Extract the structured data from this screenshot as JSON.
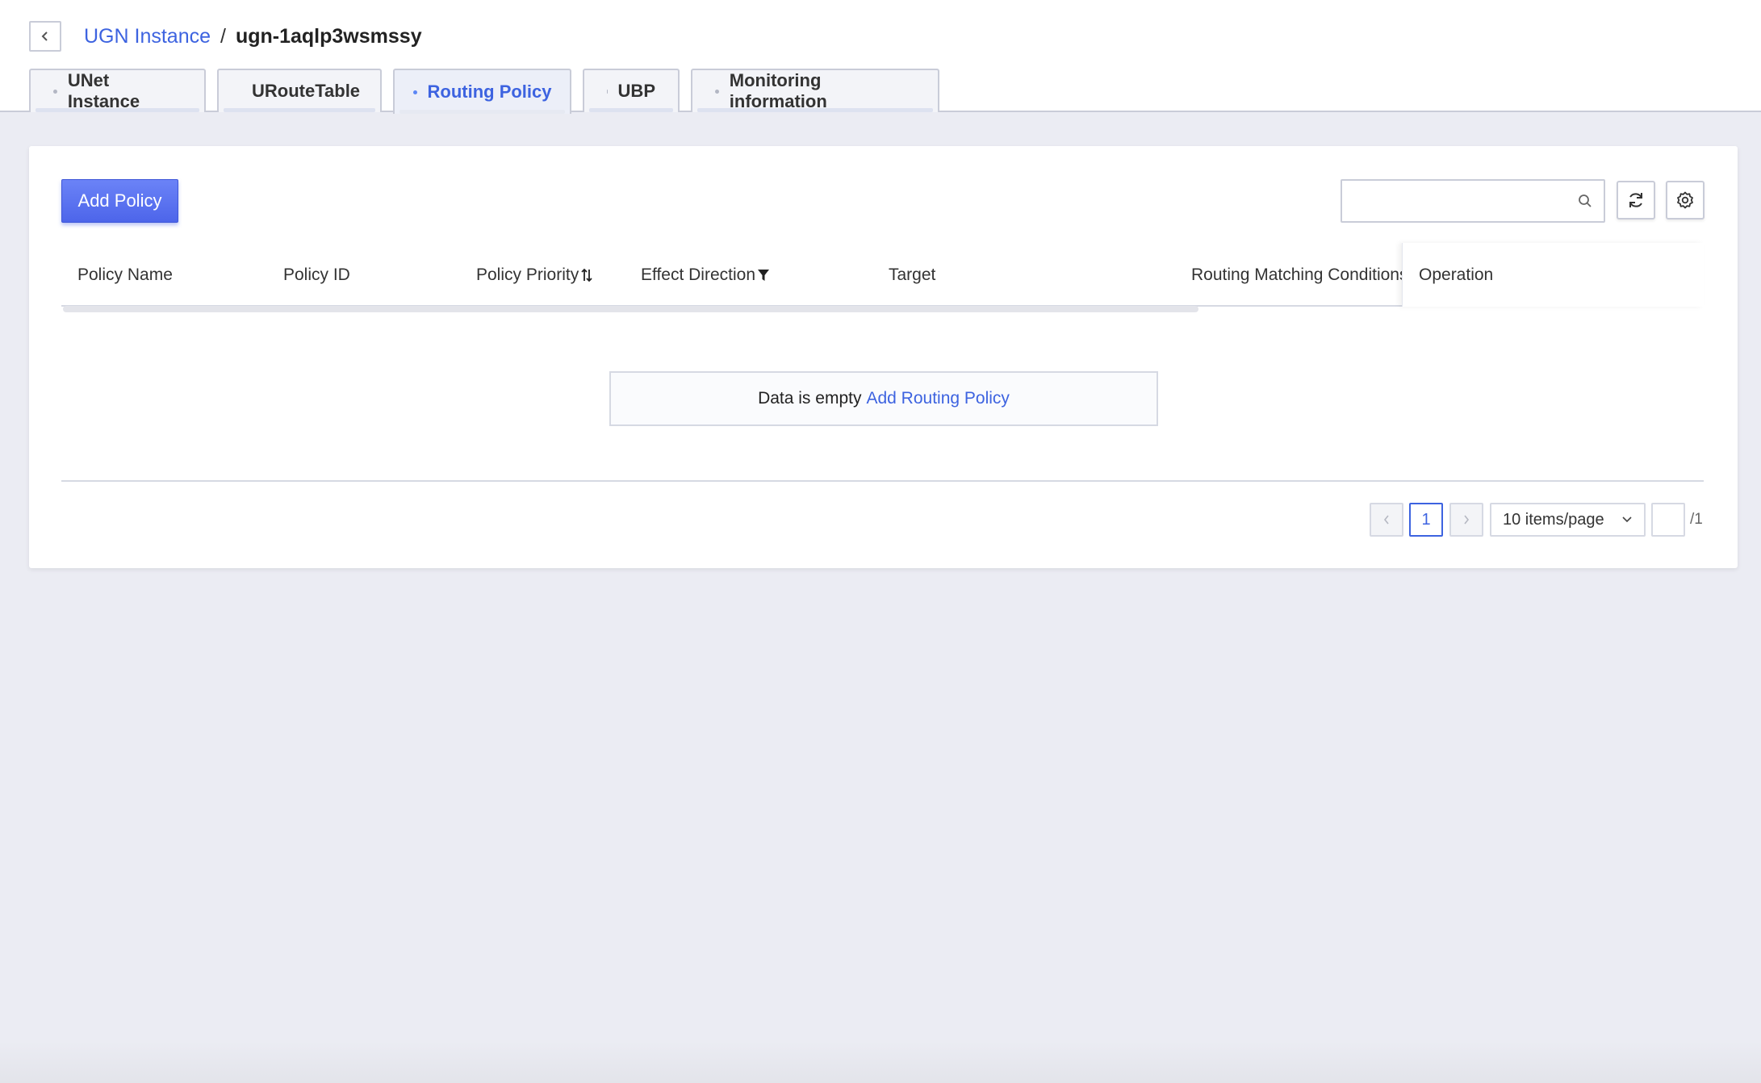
{
  "breadcrumb": {
    "parent": "UGN Instance",
    "separator": "/",
    "current": "ugn-1aqlp3wsmssy"
  },
  "tabs": [
    {
      "label": "UNet Instance",
      "active": false
    },
    {
      "label": "URouteTable",
      "active": false
    },
    {
      "label": "Routing Policy",
      "active": true
    },
    {
      "label": "UBP",
      "active": false
    },
    {
      "label": "Monitoring information",
      "active": false
    }
  ],
  "toolbar": {
    "add_label": "Add Policy",
    "search_placeholder": "",
    "search_icon": "search-icon",
    "refresh_icon": "refresh-icon",
    "settings_icon": "gear-icon"
  },
  "table": {
    "columns": [
      "Policy Name",
      "Policy ID",
      "Policy Priority",
      "Effect Direction",
      "Target",
      "Routing Matching Conditions",
      "Operation"
    ],
    "rows": []
  },
  "empty": {
    "text": "Data is empty",
    "link": "Add Routing Policy"
  },
  "pagination": {
    "current_page": "1",
    "page_size_label": "10 items/page",
    "total_pages": "/1"
  },
  "colors": {
    "accent": "#3d63e0",
    "primary_button": "#5670ef",
    "background": "#ebecf3"
  }
}
